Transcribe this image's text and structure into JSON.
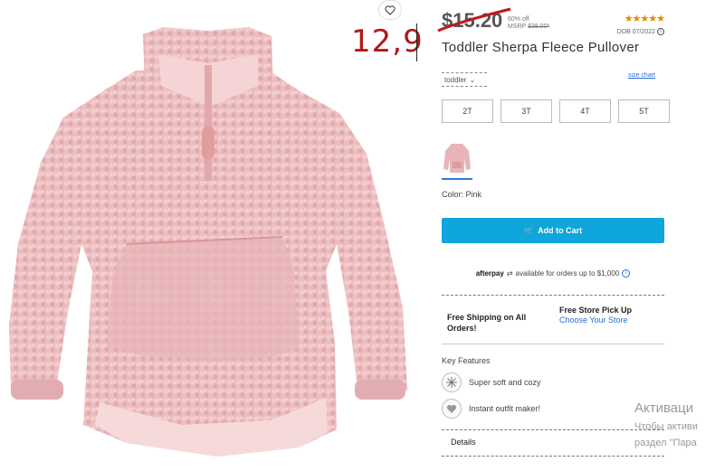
{
  "product": {
    "sale_price": "$15.20",
    "percent_off": "60% off",
    "msrp_label": "MSRP",
    "msrp_value": "$38.00*",
    "rating_stars": "★★★★★",
    "dob": "DOB 07/2022",
    "title": "Toddler Sherpa Fleece Pullover",
    "image_icon": "pink-sherpa-pullover-image"
  },
  "annotation": {
    "handwritten_price": "12,9",
    "handwritten_color": "#b0181b"
  },
  "size": {
    "selector_value": "toddler",
    "size_chart_link": "size chart",
    "options": [
      "2T",
      "3T",
      "4T",
      "5T"
    ]
  },
  "color": {
    "label": "Color: Pink",
    "swatch_color": "#e8b4b8"
  },
  "cart": {
    "add_label": "Add to Cart",
    "button_color": "#0fa6dd"
  },
  "afterpay": {
    "logo": "afterpay",
    "text": "available for orders up to $1,000"
  },
  "fulfillment": {
    "shipping": "Free Shipping on All Orders!",
    "pickup_title": "Free Store Pick Up",
    "pickup_link": "Choose Your Store"
  },
  "features": {
    "heading": "Key Features",
    "items": [
      {
        "icon": "snowflake-icon",
        "text": "Super soft and cozy"
      },
      {
        "icon": "heart-icon",
        "text": "Instant outfit maker!"
      }
    ]
  },
  "details": {
    "label": "Details"
  },
  "watermark": {
    "title": "Активаци",
    "line1": "Чтобы активи",
    "line2": "раздел \"Пара"
  }
}
